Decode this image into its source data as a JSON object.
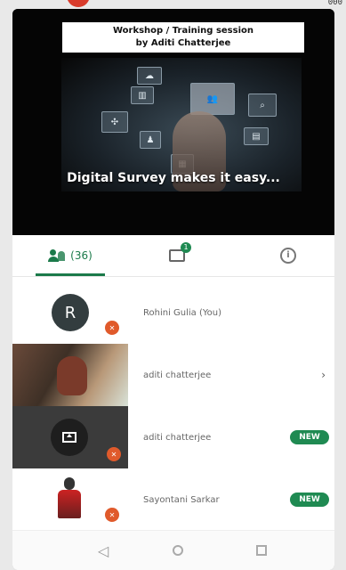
{
  "status_bar": {
    "code": "000"
  },
  "video": {
    "banner_line1": "Workshop / Training session",
    "banner_line2": "by Aditi Chatterjee",
    "caption": "Digital Survey makes it easy..."
  },
  "tabs": {
    "people_label": "(36)",
    "chat_badge": "1",
    "info_symbol": "i"
  },
  "participants": [
    {
      "name": "Rohini Gulia (You)",
      "avatar_letter": "R"
    },
    {
      "name": "aditi chatterjee"
    },
    {
      "name": "aditi chatterjee",
      "badge": "NEW"
    },
    {
      "name": "Sayontani Sarkar",
      "badge": "NEW"
    }
  ],
  "colors": {
    "accent": "#1b7a4a",
    "mic_off": "#e05a2b"
  }
}
